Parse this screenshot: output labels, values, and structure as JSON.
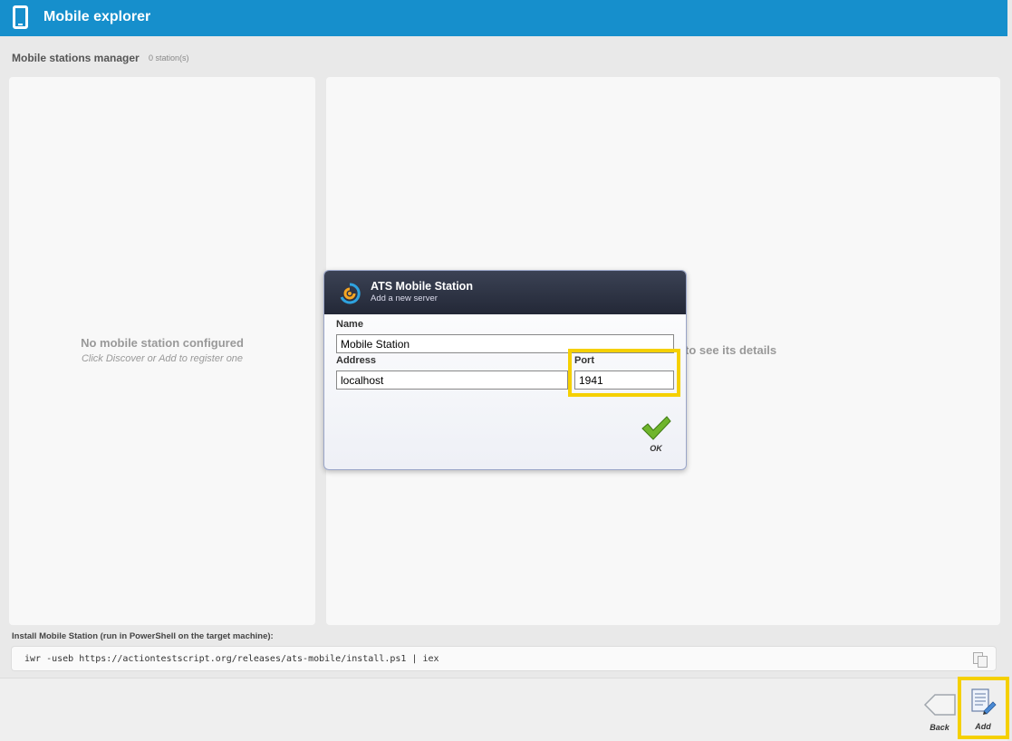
{
  "app": {
    "title": "Mobile explorer"
  },
  "manager": {
    "title": "Mobile stations manager",
    "count": "0 station(s)",
    "empty_title": "No mobile station configured",
    "empty_hint": "Click Discover or Add to register one",
    "details_hint": "to see its details"
  },
  "install": {
    "label": "Install Mobile Station (run in PowerShell on the target machine):",
    "command": "iwr -useb https://actiontestscript.org/releases/ats-mobile/install.ps1 | iex"
  },
  "dialog": {
    "title": "ATS Mobile Station",
    "subtitle": "Add a new server",
    "name_label": "Name",
    "name_value": "Mobile Station",
    "address_label": "Address",
    "address_value": "localhost",
    "port_label": "Port",
    "port_value": "1941",
    "ok_label": "OK"
  },
  "toolbar": {
    "back_label": "Back",
    "add_label": "Add"
  },
  "colors": {
    "titlebar": "#168fcc",
    "highlight": "#f5d000",
    "ok_check": "#6fb52c"
  }
}
